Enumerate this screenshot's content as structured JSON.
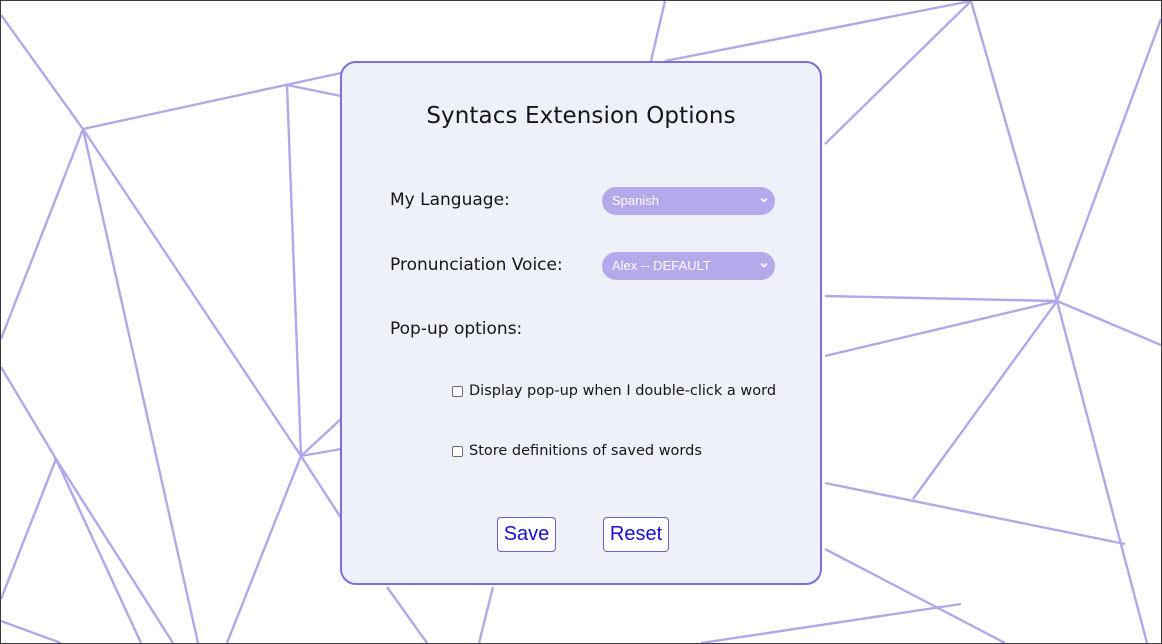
{
  "colors": {
    "accent_border": "#7f6cdd",
    "panel_background": "#eef0fa",
    "select_background": "#b5a9ec",
    "background_lines": "#b3a7ea",
    "button_text": "#1a0dcc"
  },
  "options": {
    "title": "Syntacs Extension Options",
    "language": {
      "label": "My Language:",
      "selected": "Spanish"
    },
    "voice": {
      "label": "Pronunciation Voice:",
      "selected": "Alex -- DEFAULT"
    },
    "popup": {
      "heading": "Pop-up options:",
      "checkboxes": [
        {
          "label": "Display pop-up when I double-click a word",
          "checked": false
        },
        {
          "label": "Store definitions of saved words",
          "checked": false
        }
      ]
    },
    "buttons": {
      "save": "Save",
      "reset": "Reset"
    }
  },
  "icons": {
    "dropdown": "chevron-down-icon"
  }
}
